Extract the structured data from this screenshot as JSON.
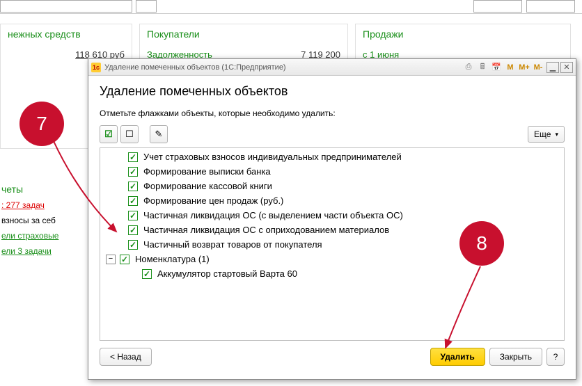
{
  "background": {
    "topbar_input": "",
    "card1_title": "нежных средств",
    "card1_value": "118 610 руб",
    "card2_title": "Покупатели",
    "card2_link": "Задолженность",
    "card2_value": "7 119 200",
    "card3_title": "Продажи",
    "card3_link": "с 1 июня",
    "side_heading": "четы",
    "side_link1": ": 277 задач",
    "side_txt1": "взносы за себ",
    "side_txt2": "ели страховые",
    "side_txt3": "ели 3 задачи"
  },
  "dialog": {
    "window_title": "Удаление помеченных объектов  (1С:Предприятие)",
    "heading": "Удаление помеченных объектов",
    "instruction": "Отметьте флажками объекты, которые необходимо удалить:",
    "more_label": "Еще",
    "items": [
      "Учет страховых взносов индивидуальных предпринимателей",
      "Формирование выписки банка",
      "Формирование кассовой книги",
      "Формирование цен продаж (руб.)",
      "Частичная ликвидация ОС (с выделением части объекта ОС)",
      "Частичная ликвидация ОС с оприходованием материалов",
      "Частичный возврат товаров от покупателя"
    ],
    "group_label": "Номенклатура (1)",
    "group_item": "Аккумулятор стартовый Варта 60",
    "back_label": "< Назад",
    "delete_label": "Удалить",
    "close_label": "Закрыть",
    "help_label": "?"
  },
  "titlebar_m": [
    "M",
    "M+",
    "M-"
  ],
  "callouts": {
    "c7": "7",
    "c8": "8"
  }
}
